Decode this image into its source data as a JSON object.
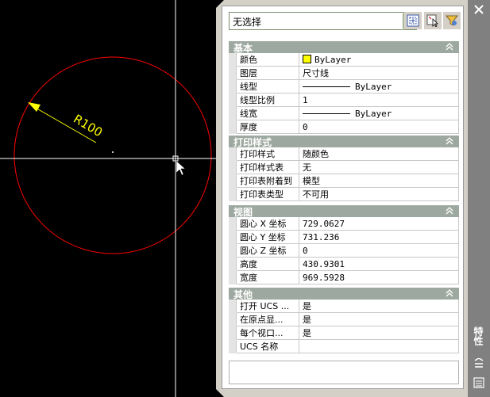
{
  "drawing": {
    "dimension_text": "R100",
    "colors": {
      "circle": "#ff0000",
      "dimension": "#ffff00",
      "crosshair": "#ffffff",
      "background": "#000000"
    }
  },
  "palette": {
    "title": "特性",
    "selection": "无选择",
    "toolbar": {
      "toggle_pickadd": "toggle-pickadd-icon",
      "select_objects": "select-objects-icon",
      "quick_select": "quick-select-icon"
    },
    "sections": {
      "general": {
        "title": "基本",
        "rows": [
          {
            "label": "颜色",
            "value": "ByLayer"
          },
          {
            "label": "图层",
            "value": "尺寸线"
          },
          {
            "label": "线型",
            "value": "ByLayer"
          },
          {
            "label": "线型比例",
            "value": "1"
          },
          {
            "label": "线宽",
            "value": "ByLayer"
          },
          {
            "label": "厚度",
            "value": "0"
          }
        ]
      },
      "plot_style": {
        "title": "打印样式",
        "rows": [
          {
            "label": "打印样式",
            "value": "随颜色"
          },
          {
            "label": "打印样式表",
            "value": "无"
          },
          {
            "label": "打印表附着到",
            "value": "模型"
          },
          {
            "label": "打印表类型",
            "value": "不可用"
          }
        ]
      },
      "view": {
        "title": "视图",
        "rows": [
          {
            "label": "圆心 X 坐标",
            "value": "729.0627"
          },
          {
            "label": "圆心 Y 坐标",
            "value": "731.236"
          },
          {
            "label": "圆心 Z 坐标",
            "value": "0"
          },
          {
            "label": "高度",
            "value": "430.9301"
          },
          {
            "label": "宽度",
            "value": "969.5928"
          }
        ]
      },
      "misc": {
        "title": "其他",
        "rows": [
          {
            "label": "打开 UCS ...",
            "value": "是"
          },
          {
            "label": "在原点显...",
            "value": "是"
          },
          {
            "label": "每个视口...",
            "value": "是"
          },
          {
            "label": "UCS 名称",
            "value": ""
          }
        ]
      }
    }
  }
}
